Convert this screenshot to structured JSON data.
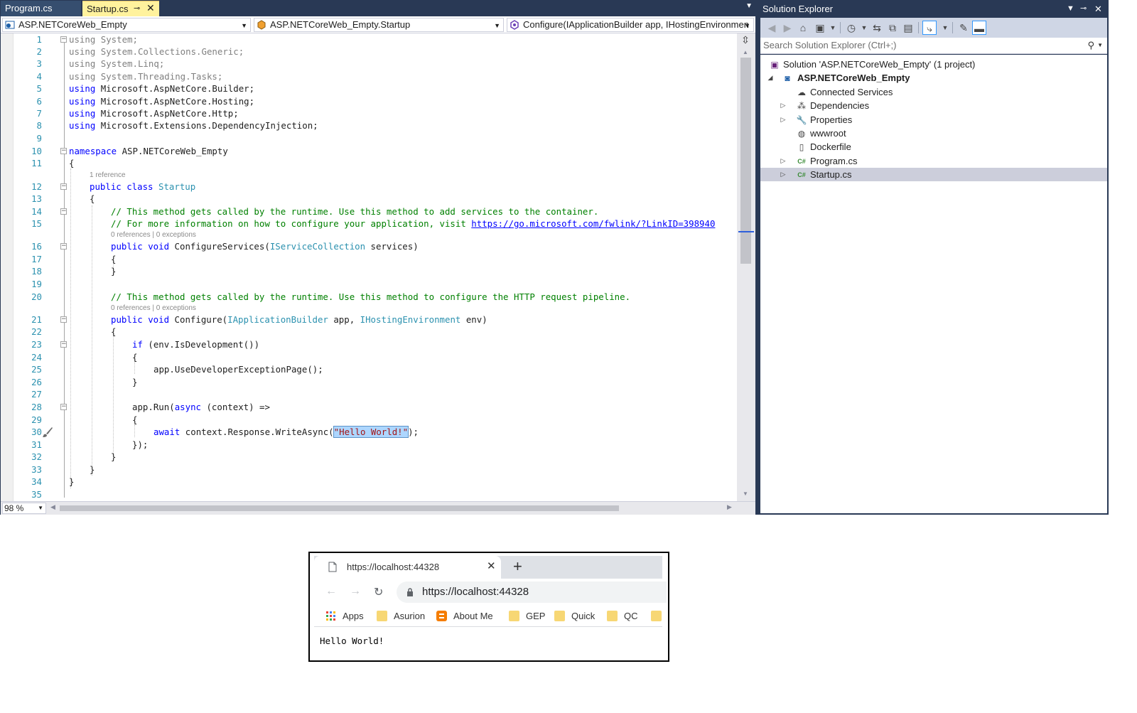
{
  "editor": {
    "tabs": [
      {
        "label": "Program.cs",
        "active": false
      },
      {
        "label": "Startup.cs",
        "active": true
      }
    ],
    "navbar": {
      "project": "ASP.NETCoreWeb_Empty",
      "class": "ASP.NETCoreWeb_Empty.Startup",
      "member": "Configure(IApplicationBuilder app, IHostingEnvironmen"
    },
    "zoom": "98 %",
    "code_lens": {
      "startup_refs": "1 reference",
      "configure_services": "0 references | 0 exceptions",
      "configure": "0 references | 0 exceptions"
    },
    "lines": [
      {
        "n": "1",
        "code": "using System;"
      },
      {
        "n": "2",
        "code": "using System.Collections.Generic;"
      },
      {
        "n": "3",
        "code": "using System.Linq;"
      },
      {
        "n": "4",
        "code": "using System.Threading.Tasks;"
      },
      {
        "n": "5",
        "code": "using Microsoft.AspNetCore.Builder;"
      },
      {
        "n": "6",
        "code": "using Microsoft.AspNetCore.Hosting;"
      },
      {
        "n": "7",
        "code": "using Microsoft.AspNetCore.Http;"
      },
      {
        "n": "8",
        "code": "using Microsoft.Extensions.DependencyInjection;"
      },
      {
        "n": "9",
        "code": ""
      },
      {
        "n": "10",
        "code": "namespace ASP.NETCoreWeb_Empty"
      },
      {
        "n": "11",
        "code": "{"
      },
      {
        "n": "12",
        "code": "public class Startup"
      },
      {
        "n": "13",
        "code": "{"
      },
      {
        "n": "14",
        "code": "// This method gets called by the runtime. Use this method to add services to the container."
      },
      {
        "n": "15",
        "code": "// For more information on how to configure your application, visit https://go.microsoft.com/fwlink/?LinkID=398940"
      },
      {
        "n": "16",
        "code": "public void ConfigureServices(IServiceCollection services)"
      },
      {
        "n": "17",
        "code": "{"
      },
      {
        "n": "18",
        "code": "}"
      },
      {
        "n": "19",
        "code": ""
      },
      {
        "n": "20",
        "code": "// This method gets called by the runtime. Use this method to configure the HTTP request pipeline."
      },
      {
        "n": "21",
        "code": "public void Configure(IApplicationBuilder app, IHostingEnvironment env)"
      },
      {
        "n": "22",
        "code": "{"
      },
      {
        "n": "23",
        "code": "if (env.IsDevelopment())"
      },
      {
        "n": "24",
        "code": "{"
      },
      {
        "n": "25",
        "code": "app.UseDeveloperExceptionPage();"
      },
      {
        "n": "26",
        "code": "}"
      },
      {
        "n": "27",
        "code": ""
      },
      {
        "n": "28",
        "code": "app.Run(async (context) =>"
      },
      {
        "n": "29",
        "code": "{"
      },
      {
        "n": "30",
        "code": "await context.Response.WriteAsync(\"Hello World!\");"
      },
      {
        "n": "31",
        "code": "});"
      },
      {
        "n": "32",
        "code": "}"
      },
      {
        "n": "33",
        "code": "}"
      },
      {
        "n": "34",
        "code": "}"
      },
      {
        "n": "35",
        "code": ""
      }
    ]
  },
  "solution_explorer": {
    "title": "Solution Explorer",
    "search_placeholder": "Search Solution Explorer (Ctrl+;)",
    "solution": "Solution 'ASP.NETCoreWeb_Empty' (1 project)",
    "project": "ASP.NETCoreWeb_Empty",
    "items": [
      {
        "label": "Connected Services",
        "icon": "connected-services-icon"
      },
      {
        "label": "Dependencies",
        "icon": "dependencies-icon"
      },
      {
        "label": "Properties",
        "icon": "wrench-icon"
      },
      {
        "label": "wwwroot",
        "icon": "globe-icon"
      },
      {
        "label": "Dockerfile",
        "icon": "file-icon"
      },
      {
        "label": "Program.cs",
        "icon": "csharp-file-icon"
      },
      {
        "label": "Startup.cs",
        "icon": "csharp-file-icon",
        "selected": true
      }
    ]
  },
  "browser": {
    "tab_title": "https://localhost:44328",
    "url": "https://localhost:44328",
    "bookmarks": [
      "Apps",
      "Asurion",
      "About Me",
      "GEP",
      "Quick",
      "QC"
    ],
    "page_text": "Hello World!"
  },
  "colors": {
    "vs_chrome": "#293955",
    "active_tab": "#fff29d",
    "keyword": "#0000ff",
    "type": "#2b91af",
    "comment": "#008000",
    "string": "#a31515",
    "selection": "#add6ff"
  }
}
